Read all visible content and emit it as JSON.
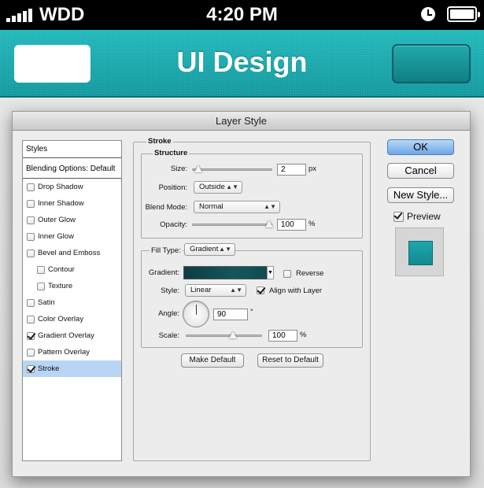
{
  "statusbar": {
    "carrier": "WDD",
    "time": "4:20 PM"
  },
  "navbar": {
    "title": "UI Design"
  },
  "dialog": {
    "title": "Layer Style",
    "styles_header": "Styles",
    "blending_options": "Blending Options: Default",
    "style_items": [
      {
        "label": "Drop Shadow",
        "checked": false
      },
      {
        "label": "Inner Shadow",
        "checked": false
      },
      {
        "label": "Outer Glow",
        "checked": false
      },
      {
        "label": "Inner Glow",
        "checked": false
      },
      {
        "label": "Bevel and Emboss",
        "checked": false
      },
      {
        "label": "Contour",
        "checked": false
      },
      {
        "label": "Texture",
        "checked": false
      },
      {
        "label": "Satin",
        "checked": false
      },
      {
        "label": "Color Overlay",
        "checked": false
      },
      {
        "label": "Gradient Overlay",
        "checked": true
      },
      {
        "label": "Pattern Overlay",
        "checked": false
      },
      {
        "label": "Stroke",
        "checked": true,
        "selected": true
      }
    ],
    "stroke": {
      "group_label": "Stroke",
      "structure_label": "Structure",
      "size_label": "Size:",
      "size_value": "2",
      "size_unit": "px",
      "position_label": "Position:",
      "position_value": "Outside",
      "blend_mode_label": "Blend Mode:",
      "blend_mode_value": "Normal",
      "opacity_label": "Opacity:",
      "opacity_value": "100",
      "opacity_unit": "%",
      "fill_type_label": "Fill Type:",
      "fill_type_value": "Gradient",
      "gradient_label": "Gradient:",
      "reverse_label": "Reverse",
      "reverse_checked": false,
      "style_label": "Style:",
      "style_value": "Linear",
      "align_label": "Align with Layer",
      "align_checked": true,
      "angle_label": "Angle:",
      "angle_value": "90",
      "angle_unit": "°",
      "scale_label": "Scale:",
      "scale_value": "100",
      "scale_unit": "%",
      "make_default": "Make Default",
      "reset_default": "Reset to Default",
      "size_slider_level": 0.02,
      "opacity_slider_level": 1.0,
      "scale_slider_level": 0.62
    },
    "buttons": {
      "ok": "OK",
      "cancel": "Cancel",
      "new_style": "New Style..."
    },
    "preview_label": "Preview",
    "preview_checked": true,
    "colors": {
      "teal": "#1aa3a8",
      "selection": "#b9d5f5",
      "ok_blue": "#6fa6e6"
    }
  }
}
